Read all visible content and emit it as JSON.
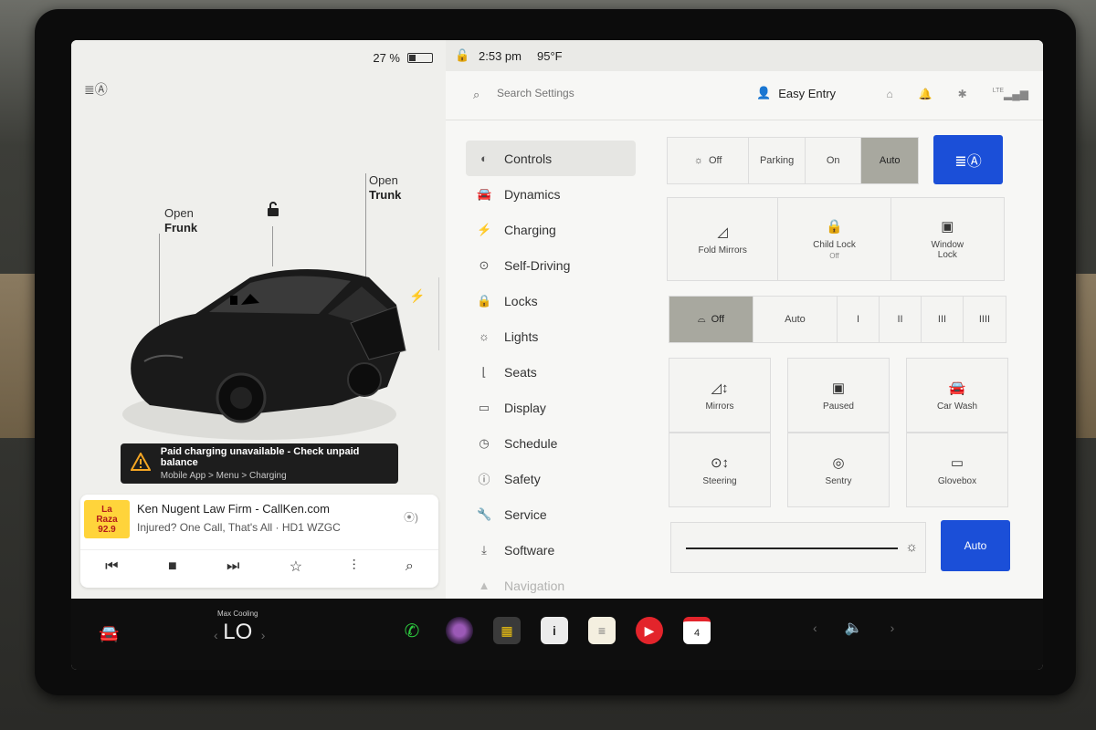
{
  "status": {
    "battery_percent": "27 %",
    "battery_level": 0.27,
    "time": "2:53 pm",
    "temperature": "95°F"
  },
  "car": {
    "frunk": {
      "line1": "Open",
      "line2": "Frunk"
    },
    "trunk": {
      "line1": "Open",
      "line2": "Trunk"
    }
  },
  "alert": {
    "title": "Paid charging unavailable - Check unpaid balance",
    "subtitle": "Mobile App > Menu > Charging"
  },
  "media": {
    "logo_line1": "La",
    "logo_line2": "Raza",
    "logo_line3": "92.9",
    "title": "Ken Nugent Law Firm - CallKen.com",
    "subtitle": "Injured? One Call, That's All · HD1 WZGC"
  },
  "search": {
    "placeholder": "Search Settings"
  },
  "profile": {
    "name": "Easy Entry"
  },
  "signal": {
    "label": "LTE"
  },
  "menu": [
    {
      "label": "Controls",
      "icon": "toggle-icon"
    },
    {
      "label": "Dynamics",
      "icon": "car-icon"
    },
    {
      "label": "Charging",
      "icon": "bolt-icon"
    },
    {
      "label": "Self-Driving",
      "icon": "steering-wheel-icon"
    },
    {
      "label": "Locks",
      "icon": "lock-icon"
    },
    {
      "label": "Lights",
      "icon": "light-icon"
    },
    {
      "label": "Seats",
      "icon": "seat-icon"
    },
    {
      "label": "Display",
      "icon": "display-icon"
    },
    {
      "label": "Schedule",
      "icon": "clock-icon"
    },
    {
      "label": "Safety",
      "icon": "safety-icon"
    },
    {
      "label": "Service",
      "icon": "wrench-icon"
    },
    {
      "label": "Software",
      "icon": "download-icon"
    },
    {
      "label": "Navigation",
      "icon": "navigation-icon"
    }
  ],
  "lights": {
    "off": "Off",
    "parking": "Parking",
    "on": "On",
    "auto": "Auto",
    "selected": "Auto"
  },
  "row2": {
    "fold_mirrors": "Fold Mirrors",
    "child_lock": "Child Lock",
    "child_lock_state": "Off",
    "window_lock_1": "Window",
    "window_lock_2": "Lock"
  },
  "wipers": {
    "off": "Off",
    "auto": "Auto",
    "s1": "I",
    "s2": "II",
    "s3": "III",
    "s4": "IIII",
    "selected": "Off"
  },
  "grid": {
    "mirrors": "Mirrors",
    "paused": "Paused",
    "car_wash": "Car Wash",
    "steering": "Steering",
    "sentry": "Sentry",
    "glovebox": "Glovebox"
  },
  "brightness": {
    "auto": "Auto"
  },
  "taskbar": {
    "climate_label": "Max Cooling",
    "climate_value": "LO",
    "calendar_day": "4"
  },
  "colors": {
    "accent": "#1b4fd8",
    "selected_segment": "#a8a89f"
  }
}
